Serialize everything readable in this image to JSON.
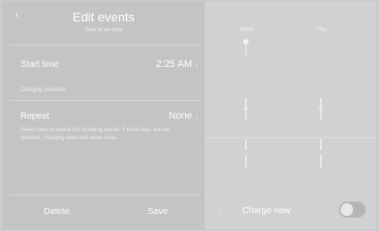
{
  "header": {
    "back_icon": "chevron-left-icon",
    "back_glyph": "‹",
    "title": "Edit events",
    "subtitle": "Start at set time"
  },
  "start_time": {
    "label": "Start time",
    "value": "2:25 AM",
    "chevron": "›"
  },
  "charging_schedule": {
    "label": "Charging schedule"
  },
  "repeat": {
    "label": "Repeat",
    "value": "None",
    "chevron": "›",
    "description": "Select days to repeat the charging events. If extra days are not selected, charging event will occur once."
  },
  "footer": {
    "delete_label": "Delete",
    "save_label": "Save"
  },
  "schedule": {
    "days": [
      "Wed",
      "Thu"
    ]
  },
  "charge_now": {
    "label": "Charge now",
    "chevron": "‹",
    "enabled": false
  }
}
